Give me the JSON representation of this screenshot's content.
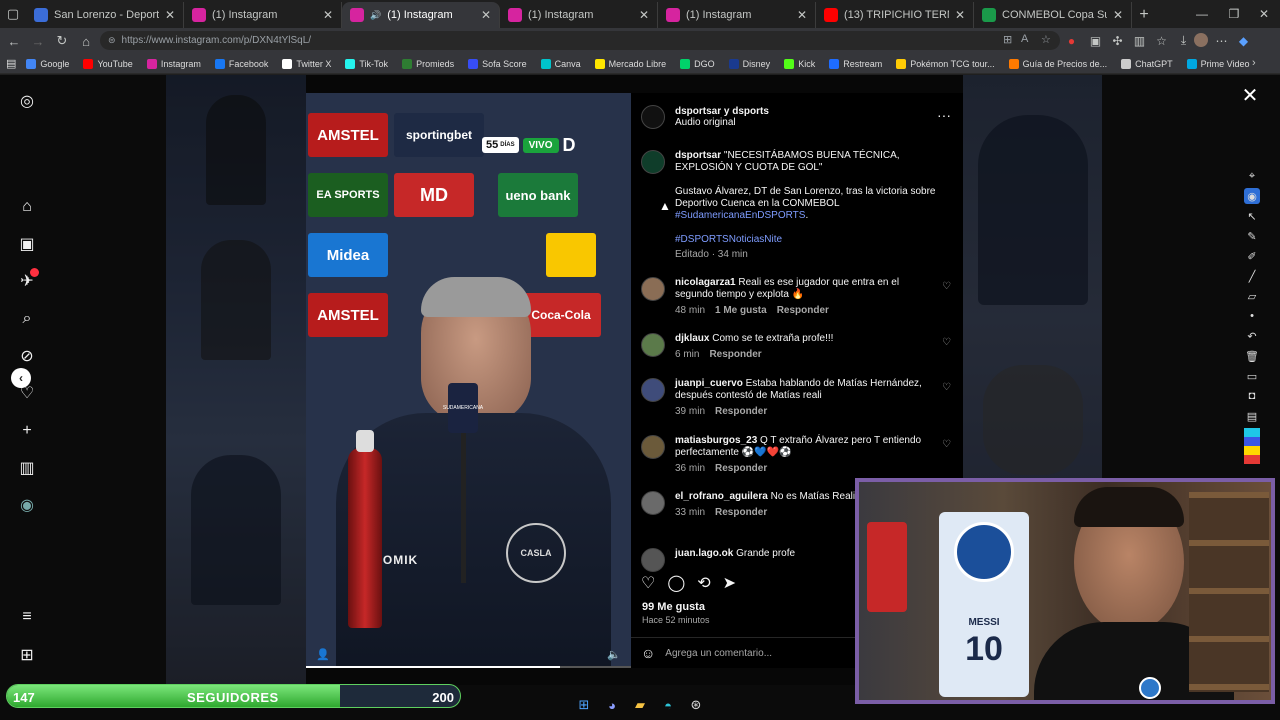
{
  "browser": {
    "tabs": [
      {
        "title": "San Lorenzo - Deportivo Cuenca e",
        "favicon_color": "#3b6dd8",
        "active": false
      },
      {
        "title": "(1) Instagram",
        "favicon_color": "#d6249f",
        "active": false
      },
      {
        "title": "(1) Instagram",
        "favicon_color": "#d6249f",
        "active": true,
        "audio": "🔊"
      },
      {
        "title": "(1) Instagram",
        "favicon_color": "#d6249f",
        "active": false
      },
      {
        "title": "(1) Instagram",
        "favicon_color": "#d6249f",
        "active": false
      },
      {
        "title": "(13) TRIPICHIO TERMINÓ DE LIQ",
        "favicon_color": "#ff0000",
        "active": false
      },
      {
        "title": "CONMEBOL Copa Sudamericana",
        "favicon_color": "#1a9a4a",
        "active": false
      }
    ],
    "url": "https://www.instagram.com/p/DXN4tYlSqL/",
    "bookmarks": [
      {
        "label": "Google",
        "color": "#4285f4"
      },
      {
        "label": "YouTube",
        "color": "#ff0000"
      },
      {
        "label": "Instagram",
        "color": "#d6249f"
      },
      {
        "label": "Facebook",
        "color": "#1877f2"
      },
      {
        "label": "Twitter X",
        "color": "#ffffff"
      },
      {
        "label": "Tik-Tok",
        "color": "#25f4ee"
      },
      {
        "label": "Promieds",
        "color": "#2e7d32"
      },
      {
        "label": "Sofa Score",
        "color": "#374df5"
      },
      {
        "label": "Canva",
        "color": "#00c4cc"
      },
      {
        "label": "Mercado Libre",
        "color": "#ffe600"
      },
      {
        "label": "DGO",
        "color": "#00d26a"
      },
      {
        "label": "Disney",
        "color": "#1a3a8f"
      },
      {
        "label": "Kick",
        "color": "#53fc18"
      },
      {
        "label": "Restream",
        "color": "#1e6cff"
      },
      {
        "label": "Pokémon TCG tour...",
        "color": "#ffcb05"
      },
      {
        "label": "Guía de Precios de...",
        "color": "#ff7a00"
      },
      {
        "label": "ChatGPT",
        "color": "#cccccc"
      },
      {
        "label": "Prime Video",
        "color": "#00a8e1"
      }
    ]
  },
  "post": {
    "author_header": "dsportsar y dsports",
    "audio": "Audio original",
    "caption_user": "dsportsar",
    "caption_headline": "\"NECESITÁBAMOS BUENA TÉCNICA, EXPLOSIÓN Y CUOTA DE GOL\"",
    "caption_body": "Gustavo Álvarez, DT de San Lorenzo, tras la victoria sobre Deportivo Cuenca en la CONMEBOL",
    "hashtag1": "#SudamericanaEnDSPORTS",
    "hashtag1_tail": ".",
    "hashtag2": "#DSPORTSNoticiasNite",
    "edited": "Editado · 34 min",
    "likes": "99 Me gusta",
    "time_ago": "Hace 52 minutos",
    "comment_placeholder": "Agrega un comentario...",
    "comments": [
      {
        "user": "nicolagarza1",
        "text": "Reali es ese jugador que entra en el segundo tiempo y explota 🔥",
        "time": "48 min",
        "likes": "1 Me gusta",
        "reply": "Responder",
        "avatar_color": "#8a6d55"
      },
      {
        "user": "djklaux",
        "text": "Como se te extraña profe!!!",
        "time": "6 min",
        "likes": "",
        "reply": "Responder",
        "avatar_color": "#5b7a4a"
      },
      {
        "user": "juanpi_cuervo",
        "text": "Estaba hablando de Matías Hernández, después contestó de Matías reali",
        "time": "39 min",
        "likes": "",
        "reply": "Responder",
        "avatar_color": "#3f4c7a"
      },
      {
        "user": "matiasburgos_23",
        "text": "Q T extraño Álvarez pero T entiendo perfectamente ⚽💙❤️⚽",
        "time": "36 min",
        "likes": "",
        "reply": "Responder",
        "avatar_color": "#6b5a3a"
      },
      {
        "user": "el_rofrano_aguilera",
        "text": "No es Matías Reali Hernández",
        "time": "33 min",
        "likes": "",
        "reply": "Responder",
        "avatar_color": "#6a6a6a"
      },
      {
        "user": "juan.lago.ok",
        "text": "Grande profe",
        "time": "",
        "likes": "",
        "reply": "",
        "avatar_color": "#555555"
      }
    ]
  },
  "video": {
    "days_badge": "55",
    "days_label": "DÍAS",
    "live_badge": "VIVO",
    "sponsors": [
      "AMSTEL",
      "sportingbet",
      "ueno bank",
      "Midea",
      "Coca-Cola",
      "EA SPORTS",
      "MD",
      "AMSTEL"
    ],
    "shirt_brand": "ATOMIK",
    "shirt_badge": "SUDAMERICANA",
    "crest": "CASLA"
  },
  "followers": {
    "current": "147",
    "label": "SEGUIDORES",
    "goal": "200",
    "progress_fraction": 0.735
  },
  "webcam": {
    "jersey_name": "MESSI",
    "jersey_number": "10"
  },
  "colors": {
    "ig_link": "#7e9cff",
    "progress_green": "#2fa82f",
    "webcam_border": "#7b5ea7"
  }
}
